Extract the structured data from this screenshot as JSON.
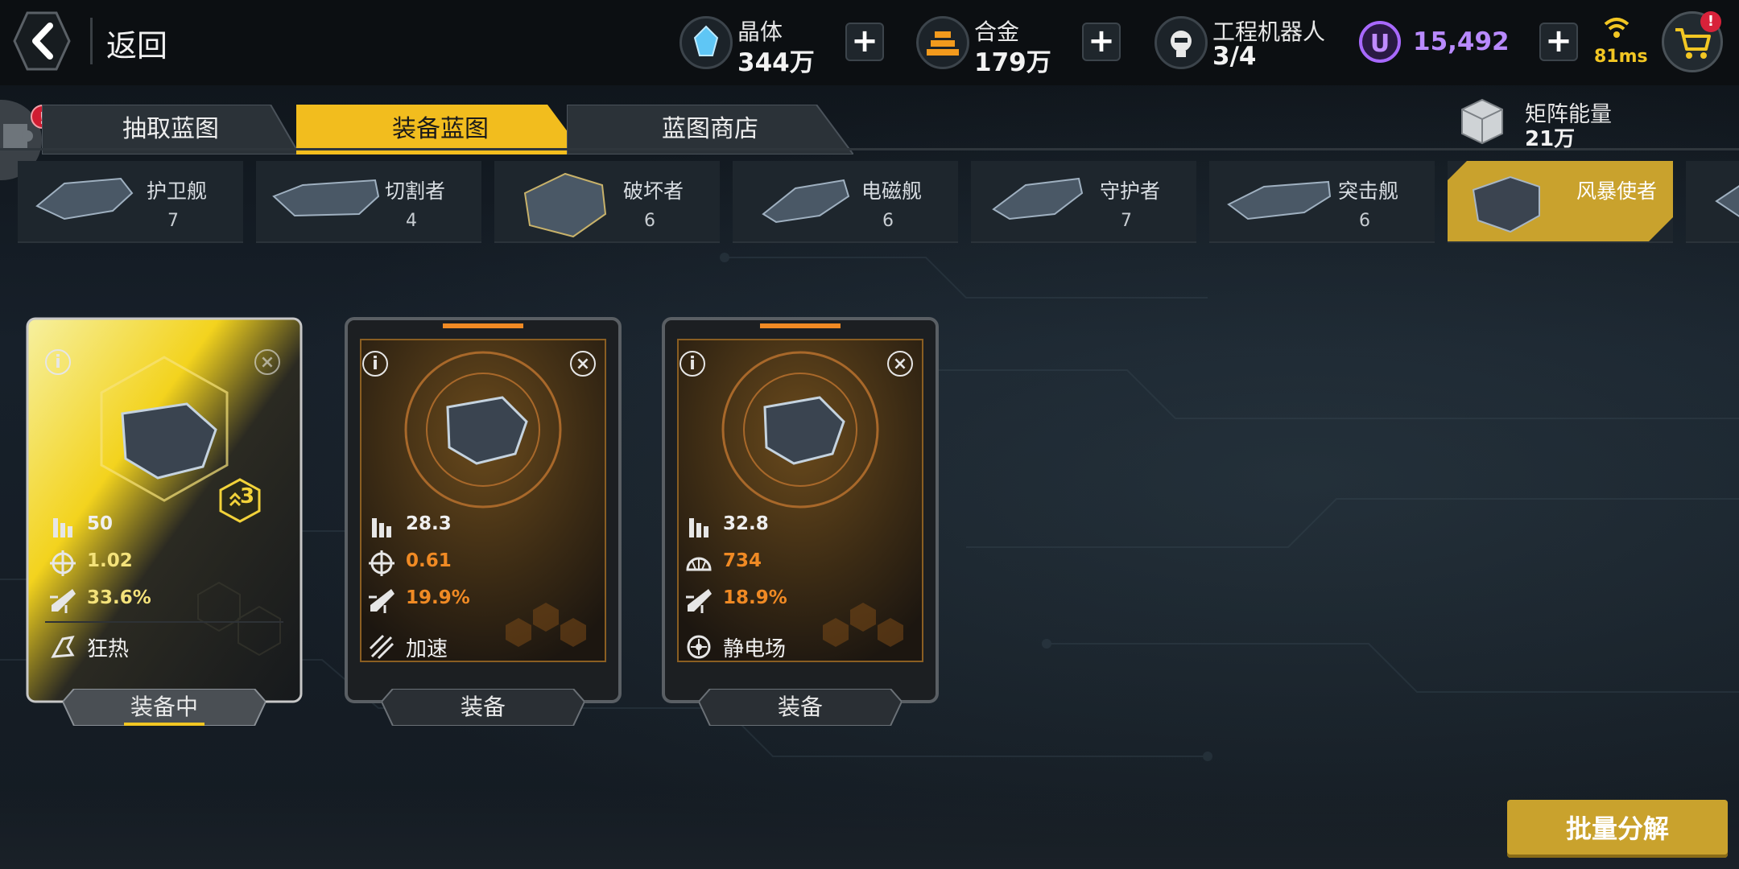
{
  "header": {
    "back_label": "返回",
    "resources": [
      {
        "name": "晶体",
        "value": "344万",
        "icon": "crystal-icon"
      },
      {
        "name": "合金",
        "value": "179万",
        "icon": "alloy-icon"
      },
      {
        "name": "工程机器人",
        "value": "3/4",
        "icon": "robot-icon"
      }
    ],
    "premium": {
      "symbol": "U",
      "value": "15,492"
    },
    "ping": "81ms",
    "cart_badge": "!"
  },
  "tabs": [
    {
      "label": "抽取蓝图",
      "active": false,
      "alert": "!"
    },
    {
      "label": "装备蓝图",
      "active": true
    },
    {
      "label": "蓝图商店",
      "active": false
    }
  ],
  "matrix_energy": {
    "label": "矩阵能量",
    "value": "21万"
  },
  "ships": [
    {
      "name": "护卫舰",
      "count": "7"
    },
    {
      "name": "切割者",
      "count": "4"
    },
    {
      "name": "破坏者",
      "count": "6"
    },
    {
      "name": "电磁舰",
      "count": "6"
    },
    {
      "name": "守护者",
      "count": "7"
    },
    {
      "name": "突击舰",
      "count": "6"
    },
    {
      "name": "风暴使者",
      "count": "",
      "active": true
    }
  ],
  "cards": [
    {
      "equipped": true,
      "rank": "3",
      "stats": [
        {
          "icon": "ammo-icon",
          "value": "50"
        },
        {
          "icon": "crosshair-icon",
          "value": "1.02"
        },
        {
          "icon": "rocket-icon",
          "value": "33.6%"
        }
      ],
      "skill": {
        "icon": "frenzy-icon",
        "label": "狂热"
      },
      "button": "装备中"
    },
    {
      "equipped": false,
      "stats": [
        {
          "icon": "ammo-icon",
          "value": "28.3"
        },
        {
          "icon": "crosshair-icon",
          "value": "0.61"
        },
        {
          "icon": "rocket-icon",
          "value": "19.9%"
        }
      ],
      "skill": {
        "icon": "accelerate-icon",
        "label": "加速"
      },
      "button": "装备"
    },
    {
      "equipped": false,
      "stats": [
        {
          "icon": "ammo-icon",
          "value": "32.8"
        },
        {
          "icon": "shield-dome-icon",
          "value": "734"
        },
        {
          "icon": "rocket-icon",
          "value": "18.9%"
        }
      ],
      "skill": {
        "icon": "static-field-icon",
        "label": "静电场"
      },
      "button": "装备"
    }
  ],
  "batch_button": "批量分解",
  "colors": {
    "gold": "#c9a22d",
    "orange_stat": "#f08a24",
    "yellow_stat": "#f4e27a",
    "purple": "#a869ff"
  }
}
